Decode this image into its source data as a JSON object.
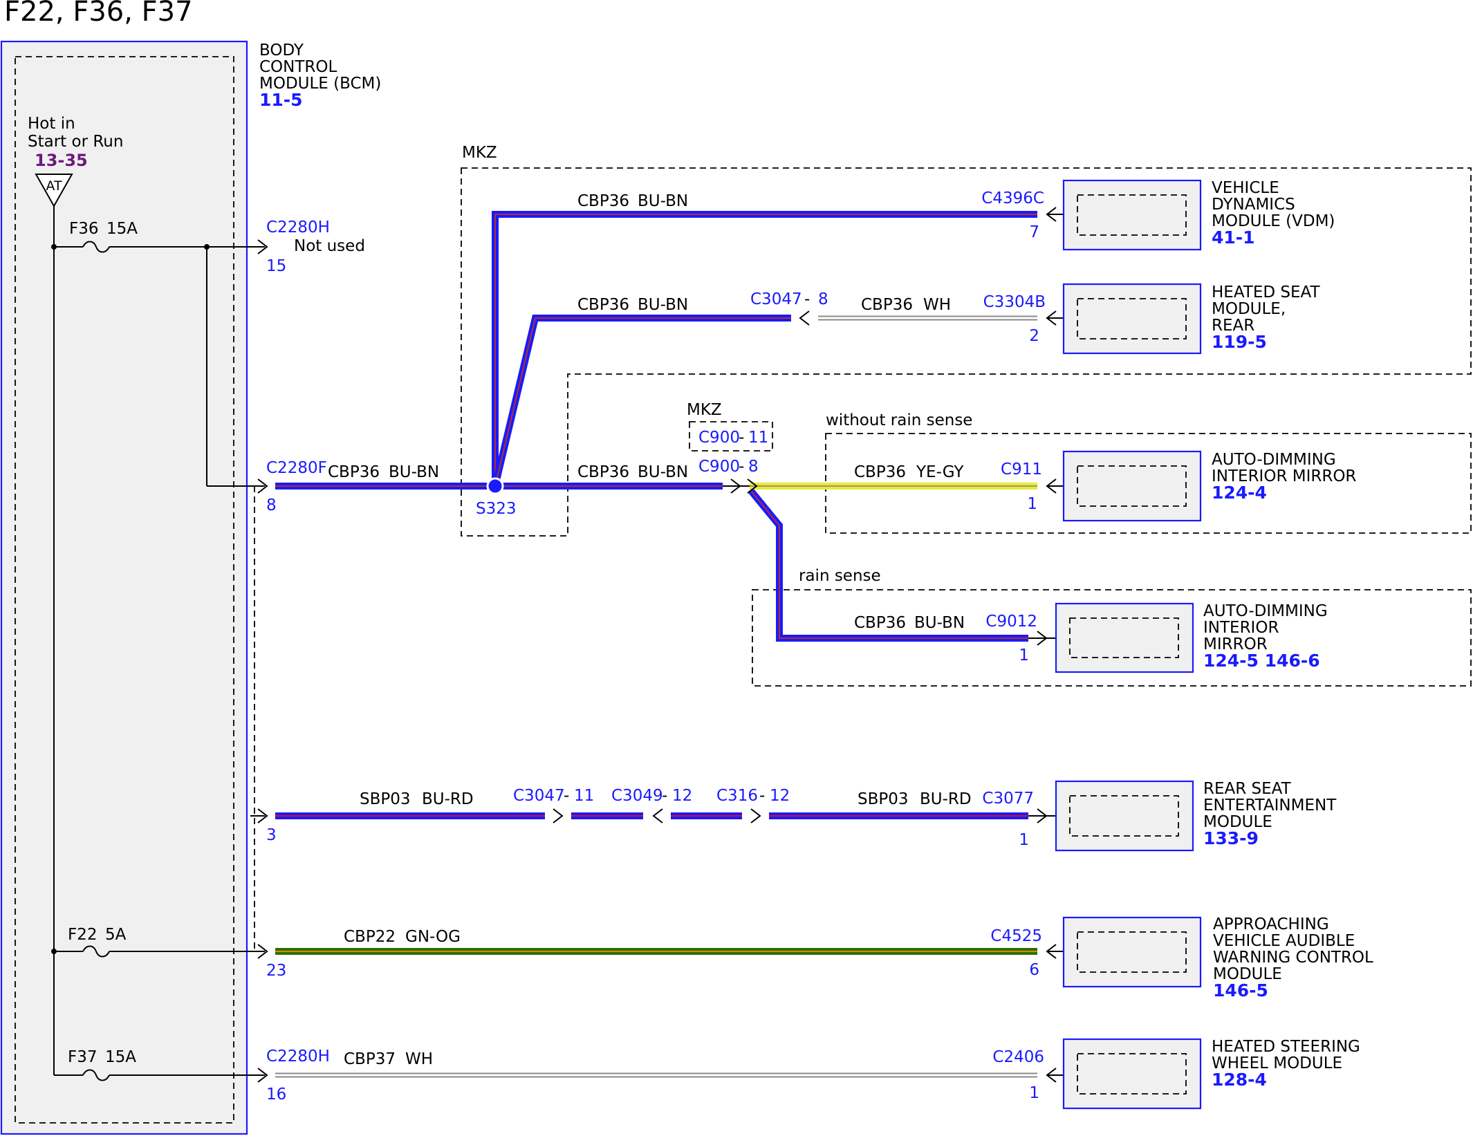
{
  "title": "F22, F36, F37",
  "bcm": {
    "name_lines": [
      "BODY",
      "CONTROL",
      "MODULE (BCM)"
    ],
    "ref": "11-5"
  },
  "power": {
    "line1": "Hot in",
    "line2": "Start or Run",
    "ref": "13-35",
    "symbol": "AT"
  },
  "fuses": {
    "f36": "F36",
    "f36_rating": "15A",
    "f22": "F22",
    "f22_rating": "5A",
    "f37": "F37",
    "f37_rating": "15A"
  },
  "labels": {
    "mkz_top": "MKZ",
    "mkz_small": "MKZ",
    "not_used": "Not used",
    "without_rain": "without rain sense",
    "rain": "rain sense"
  },
  "connectors": {
    "c2280h_a": "C2280H",
    "c2280h_a_pin": "15",
    "c2280f": "C2280F",
    "c2280f_pin": "8",
    "c2280h_b": "C2280H",
    "c2280h_b_pin": "16",
    "bcm_pin3": "3",
    "bcm_pin23": "23",
    "s323": "S323",
    "c4396c": "C4396C",
    "c4396c_pin": "7",
    "c3047_8": "C3047",
    "c3047_8_pin": "8",
    "c3304b": "C3304B",
    "c3304b_pin": "2",
    "c900_11": "C900",
    "c900_11_pin": "11",
    "c900_8": "C900",
    "c900_8_pin": "8",
    "c911": "C911",
    "c911_pin": "1",
    "c9012": "C9012",
    "c9012_pin": "1",
    "c3047_11": "C3047",
    "c3047_11_pin": "11",
    "c3049": "C3049",
    "c3049_pin": "12",
    "c316": "C316",
    "c316_pin": "12",
    "c3077": "C3077",
    "c3077_pin": "1",
    "c4525": "C4525",
    "c4525_pin": "6",
    "c2406": "C2406",
    "c2406_pin": "1",
    "dash": "-"
  },
  "wires": {
    "cbp36": "CBP36",
    "sbp03": "SBP03",
    "cbp22": "CBP22",
    "cbp37": "CBP37",
    "bu_bn": "BU-BN",
    "wh": "WH",
    "ye_gy": "YE-GY",
    "bu_rd": "BU-RD",
    "gn_og": "GN-OG"
  },
  "modules": {
    "vdm": {
      "lines": [
        "VEHICLE",
        "DYNAMICS",
        "MODULE (VDM)"
      ],
      "ref": "41-1"
    },
    "hsm_rear": {
      "lines": [
        "HEATED SEAT",
        "MODULE,",
        "REAR"
      ],
      "ref": "119-5"
    },
    "mirror1": {
      "lines": [
        "AUTO-DIMMING",
        "INTERIOR MIRROR"
      ],
      "ref": "124-4"
    },
    "mirror2": {
      "lines": [
        "AUTO-DIMMING",
        "INTERIOR",
        "MIRROR"
      ],
      "ref": "124-5 146-6"
    },
    "rse": {
      "lines": [
        "REAR SEAT",
        "ENTERTAINMENT",
        "MODULE"
      ],
      "ref": "133-9"
    },
    "avas": {
      "lines": [
        "APPROACHING",
        "VEHICLE AUDIBLE",
        "WARNING CONTROL",
        "MODULE"
      ],
      "ref": "146-5"
    },
    "hswm": {
      "lines": [
        "HEATED STEERING",
        "WHEEL MODULE"
      ],
      "ref": "128-4"
    }
  },
  "colors": {
    "bu_bn_outer": "#1a1aff",
    "bu_bn_inner": "#b0302a",
    "gn_og_outer": "#2e6f00",
    "gn_og_inner": "#d98a00",
    "ye_gy_outer": "#e9e93a",
    "ye_gy_inner": "#9a9a6a",
    "wh_outer": "#8a8a8a",
    "wh_inner": "#ffffff",
    "bu_rd_outer": "#1a1aff",
    "bu_rd_inner": "#e01010"
  }
}
